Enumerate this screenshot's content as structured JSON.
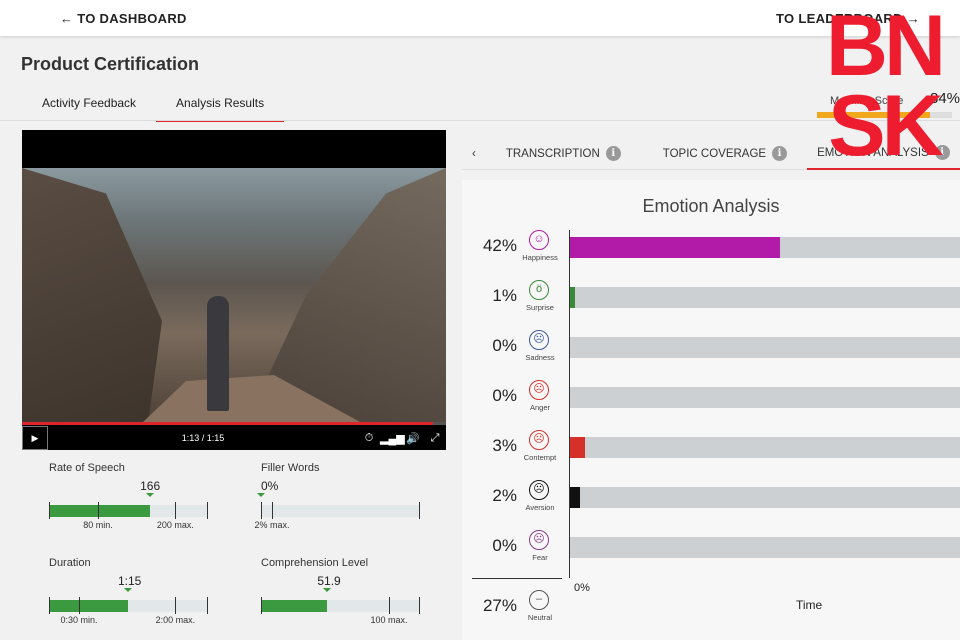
{
  "topbar": {
    "back": "← TO DASHBOARD",
    "forward": "TO LEADERBOARD →"
  },
  "title": "Product Certification",
  "tabs": [
    {
      "label": "Activity Feedback"
    },
    {
      "label": "Analysis Results"
    }
  ],
  "machine_score": {
    "label": "Machine Score",
    "value": "84%",
    "fraction": 0.84
  },
  "video": {
    "time": "1:13 / 1:15",
    "progress": 0.97
  },
  "metrics": [
    {
      "label": "Rate of Speech",
      "value": "166",
      "fill": 0.64,
      "ticks": [
        {
          "label": "80 min.",
          "pos": 0.31
        },
        {
          "label": "200 max.",
          "pos": 0.8
        }
      ]
    },
    {
      "label": "Filler Words",
      "value": "0%",
      "fill": 0,
      "ticks": [
        {
          "label": "2% max.",
          "pos": 0.07
        }
      ]
    },
    {
      "label": "Duration",
      "value": "1:15",
      "fill": 0.5,
      "ticks": [
        {
          "label": "0:30 min.",
          "pos": 0.19
        },
        {
          "label": "2:00 max.",
          "pos": 0.8
        }
      ]
    },
    {
      "label": "Comprehension Level",
      "value": "51.9",
      "fill": 0.42,
      "ticks": [
        {
          "label": "100 max.",
          "pos": 0.81
        }
      ]
    }
  ],
  "right_tabs": [
    {
      "label": "TRANSCRIPTION"
    },
    {
      "label": "TOPIC COVERAGE"
    },
    {
      "label": "EMOTION ANALYSIS"
    }
  ],
  "emotion": {
    "title": "Emotion Analysis",
    "xlabel": "Time",
    "x0": "0%",
    "scale_max": 78,
    "rows": [
      {
        "pct": "42%",
        "value": 42,
        "label": "Happiness",
        "icon": "☺",
        "color": "#b21ba8",
        "icon_color": "#b21ba8"
      },
      {
        "pct": "1%",
        "value": 1,
        "label": "Surprise",
        "icon": "ö",
        "color": "#3a8a3a",
        "icon_color": "#3a8a3a"
      },
      {
        "pct": "0%",
        "value": 0,
        "label": "Sadness",
        "icon": "☹",
        "color": "#3a5a9a",
        "icon_color": "#3a5a9a"
      },
      {
        "pct": "0%",
        "value": 0,
        "label": "Anger",
        "icon": "☹",
        "color": "#d6302a",
        "icon_color": "#d6302a"
      },
      {
        "pct": "3%",
        "value": 3,
        "label": "Contempt",
        "icon": "☹",
        "color": "#d6302a",
        "icon_color": "#d6302a"
      },
      {
        "pct": "2%",
        "value": 2,
        "label": "Aversion",
        "icon": "☹",
        "color": "#111111",
        "icon_color": "#111111"
      },
      {
        "pct": "0%",
        "value": 0,
        "label": "Fear",
        "icon": "☹",
        "color": "#8a3a8a",
        "icon_color": "#8a3a8a"
      }
    ],
    "neutral": {
      "pct": "27%",
      "label": "Neutral",
      "icon": "😐"
    }
  },
  "logo": {
    "text": "BNSK",
    "color": "#ed1c2e"
  }
}
